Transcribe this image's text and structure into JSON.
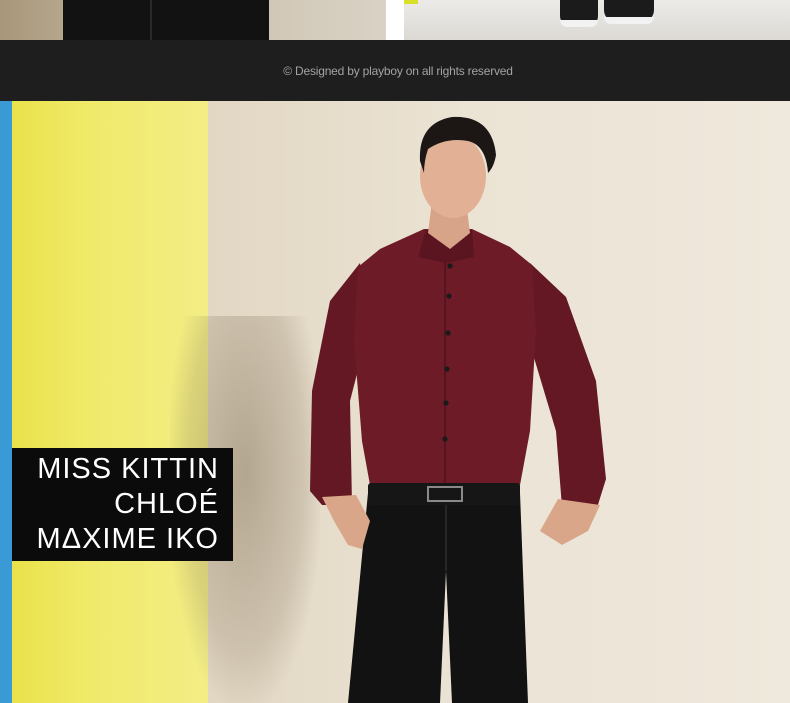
{
  "footer": {
    "copyright": "© Designed by playboy on all rights reserved"
  },
  "hero": {
    "badge_lines": [
      "MISS KITTIN",
      "CHLOÉ",
      "MΔXIME IKO"
    ]
  },
  "colors": {
    "footer_band": "#1e1e1e",
    "shirt": "#6b1a26",
    "pants": "#121212",
    "yellow_wall": "#ece55a",
    "blue_wall": "#3a9ad6",
    "cream_wall": "#e9e0cf",
    "badge_bg": "#0b0b0b"
  }
}
